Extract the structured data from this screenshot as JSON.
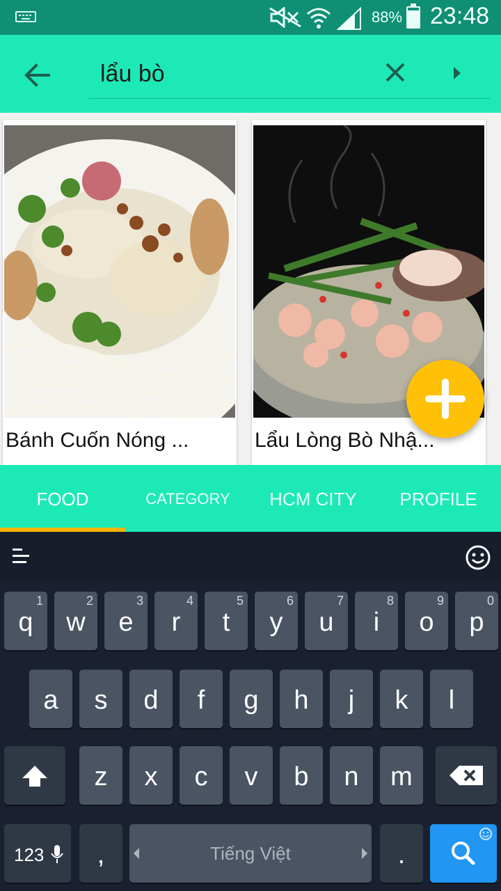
{
  "status_bar": {
    "battery_percent": "88%",
    "time": "23:48",
    "colors": {
      "background": "#0f8f74"
    }
  },
  "search": {
    "query": "lẩu bò",
    "icons": [
      "back-arrow-icon",
      "clear-icon",
      "play-arrow-icon"
    ]
  },
  "results": [
    {
      "title": "Bánh Cuốn Nóng ..."
    },
    {
      "title": "Lẩu Lòng Bò Nhậ..."
    }
  ],
  "tabs": [
    {
      "label": "FOOD",
      "active": true
    },
    {
      "label": "CATEGORY",
      "active": false
    },
    {
      "label": "HCM CITY",
      "active": false
    },
    {
      "label": "PROFILE",
      "active": false
    }
  ],
  "keyboard": {
    "row1": [
      {
        "char": "q",
        "num": "1"
      },
      {
        "char": "w",
        "num": "2"
      },
      {
        "char": "e",
        "num": "3"
      },
      {
        "char": "r",
        "num": "4"
      },
      {
        "char": "t",
        "num": "5"
      },
      {
        "char": "y",
        "num": "6"
      },
      {
        "char": "u",
        "num": "7"
      },
      {
        "char": "i",
        "num": "8"
      },
      {
        "char": "o",
        "num": "9"
      },
      {
        "char": "p",
        "num": "0"
      }
    ],
    "row2": [
      "a",
      "s",
      "d",
      "f",
      "g",
      "h",
      "j",
      "k",
      "l"
    ],
    "row3": [
      "z",
      "x",
      "c",
      "v",
      "b",
      "n",
      "m"
    ],
    "numbers_key": "123",
    "comma_key": ",",
    "space_label": "Tiếng Việt",
    "period_key": ".",
    "colors": {
      "accent": "#1de9b6",
      "fab": "#ffc107",
      "tab_indicator": "#ffb300",
      "search_key": "#2196f3"
    }
  }
}
